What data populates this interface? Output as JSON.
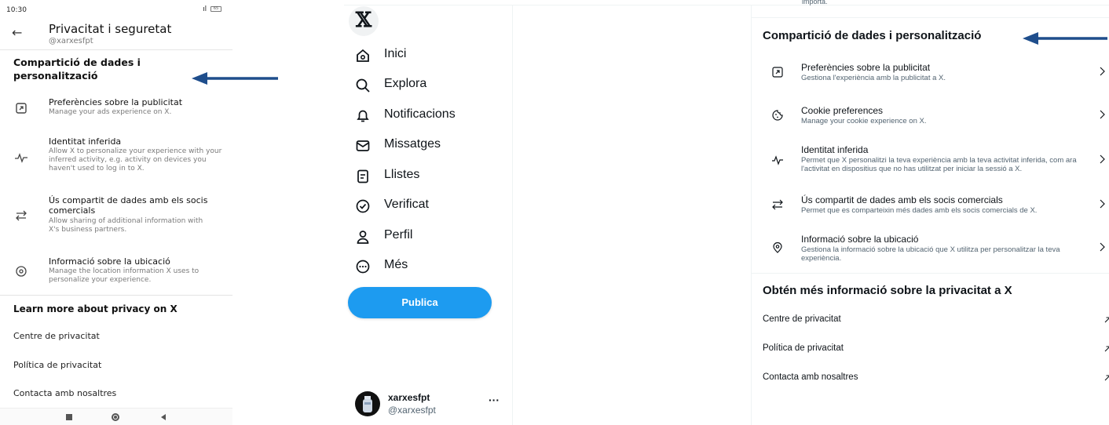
{
  "mobile": {
    "status": {
      "time": "10:30",
      "signal": "ᵀᵈıl",
      "battery": "65"
    },
    "header": {
      "back_icon": "arrow-left-icon",
      "title": "Privacitat i seguretat",
      "handle": "@xarxesfpt"
    },
    "section_title": "Compartició de dades i personalització",
    "items": [
      {
        "icon": "external-box-icon",
        "title": "Preferències sobre la publicitat",
        "subtitle": "Manage your ads experience on X."
      },
      {
        "icon": "activity-pulse-icon",
        "title": "Identitat inferida",
        "subtitle": "Allow X to personalize your experience with your inferred activity, e.g. activity on devices you haven't used to log in to X."
      },
      {
        "icon": "swap-arrows-icon",
        "title": "Ús compartit de dades amb els socis comercials",
        "subtitle": "Allow sharing of additional information with X's business partners."
      },
      {
        "icon": "location-pin-icon",
        "title": "Informació sobre la ubicació",
        "subtitle": "Manage the location information X uses to personalize your experience."
      }
    ],
    "more_title": "Learn more about privacy on X",
    "links": [
      "Centre de privacitat",
      "Política de privacitat",
      "Contacta amb nosaltres"
    ]
  },
  "desktop": {
    "logo": "𝕏",
    "nav": [
      {
        "icon": "home-icon",
        "label": "Inici"
      },
      {
        "icon": "search-icon",
        "label": "Explora"
      },
      {
        "icon": "bell-icon",
        "label": "Notificacions"
      },
      {
        "icon": "mail-icon",
        "label": "Missatges"
      },
      {
        "icon": "list-icon",
        "label": "Llistes"
      },
      {
        "icon": "verified-badge-icon",
        "label": "Verificat"
      },
      {
        "icon": "person-icon",
        "label": "Perfil"
      },
      {
        "icon": "more-circle-icon",
        "label": "Més"
      }
    ],
    "post_button": "Publica",
    "account": {
      "name": "xarxesfpt",
      "handle": "@xarxesfpt",
      "more": "···"
    },
    "cut_text": "importa.",
    "section_title": "Compartició de dades i personalització",
    "items": [
      {
        "icon": "external-box-icon",
        "title": "Preferències sobre la publicitat",
        "subtitle": "Gestiona l'experiència amb la publicitat a X."
      },
      {
        "icon": "cookie-icon",
        "title": "Cookie preferences",
        "subtitle": "Manage your cookie experience on X."
      },
      {
        "icon": "activity-pulse-icon",
        "title": "Identitat inferida",
        "subtitle": "Permet que X personalitzi la teva experiència amb la teva activitat inferida, com ara l'activitat en dispositius que no has utilitzat per iniciar la sessió a X."
      },
      {
        "icon": "swap-arrows-icon",
        "title": "Ús compartit de dades amb els socis comercials",
        "subtitle": "Permet que es comparteixin més dades amb els socis comercials de X."
      },
      {
        "icon": "location-pin-icon",
        "title": "Informació sobre la ubicació",
        "subtitle": "Gestiona la informació sobre la ubicació que X utilitza per personalitzar la teva experiència."
      }
    ],
    "more_title": "Obtén més informació sobre la privacitat a X",
    "links": [
      "Centre de privacitat",
      "Política de privacitat",
      "Contacta amb nosaltres"
    ]
  },
  "colors": {
    "accent": "#1d9bf0",
    "annotation_arrow": "#1f4e8c",
    "text": "#0f1419",
    "muted": "#536471"
  }
}
